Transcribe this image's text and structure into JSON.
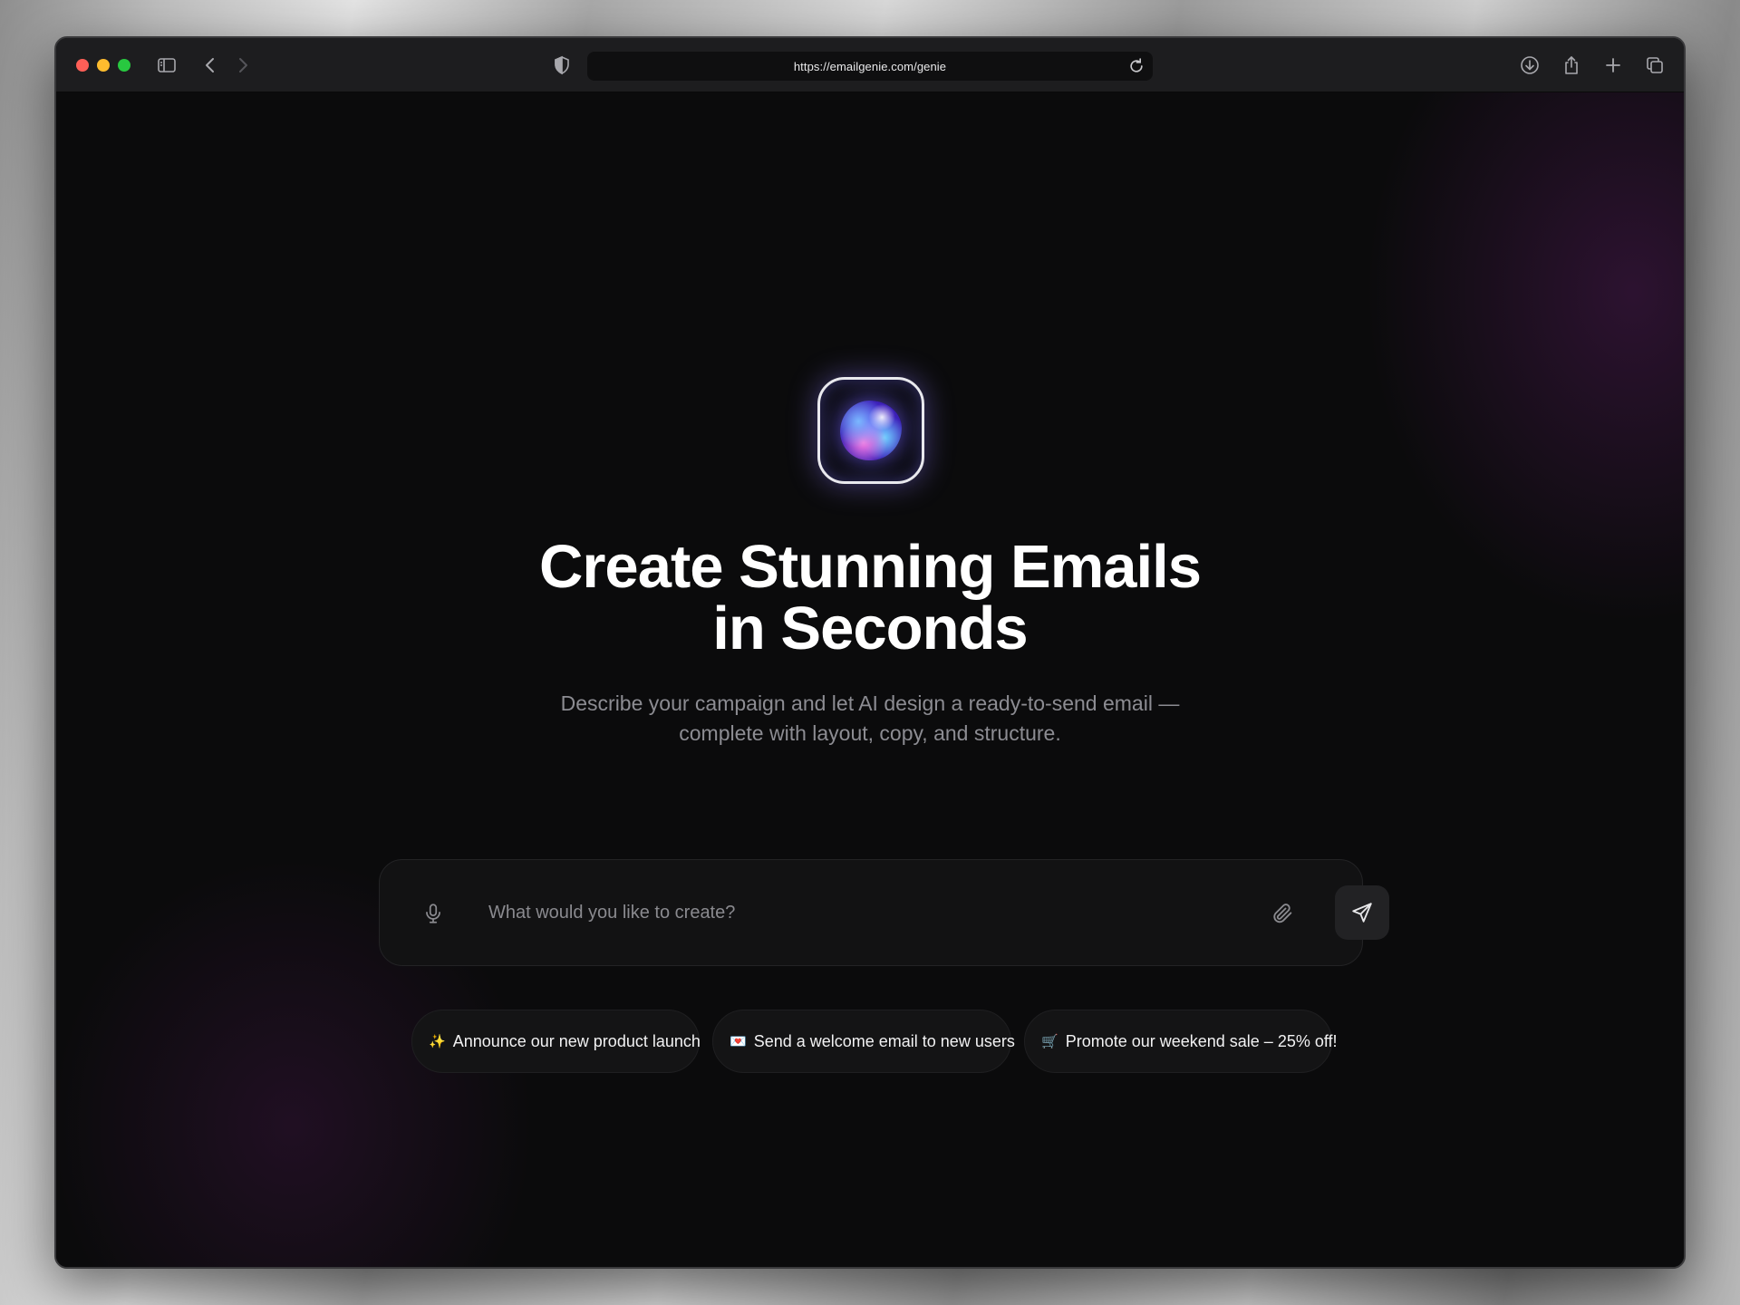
{
  "browser": {
    "url": "https://emailgenie.com/genie"
  },
  "hero": {
    "headline_line1": "Create Stunning Emails",
    "headline_line2": "in Seconds",
    "subtitle_line1": "Describe your campaign and let AI design a ready-to-send email —",
    "subtitle_line2": "complete with layout, copy, and structure."
  },
  "prompt": {
    "placeholder": "What would you like to create?",
    "value": ""
  },
  "suggestions": [
    {
      "emoji": "✨",
      "label": "Announce our new product launch"
    },
    {
      "emoji": "💌",
      "label": "Send a welcome email to new users"
    },
    {
      "emoji": "🛒",
      "label": "Promote our weekend sale – 25% off!"
    }
  ],
  "colors": {
    "background": "#0b0b0c",
    "toolbar": "#1d1d1f",
    "accent_glow": "#7a5cff",
    "text_primary": "#ffffff",
    "text_secondary": "#8c8c92"
  },
  "icons": [
    "sidebar-icon",
    "back-icon",
    "forward-icon",
    "shield-icon",
    "reload-icon",
    "download-icon",
    "share-icon",
    "new-tab-icon",
    "tabs-overview-icon",
    "microphone-icon",
    "paperclip-icon",
    "send-icon"
  ]
}
